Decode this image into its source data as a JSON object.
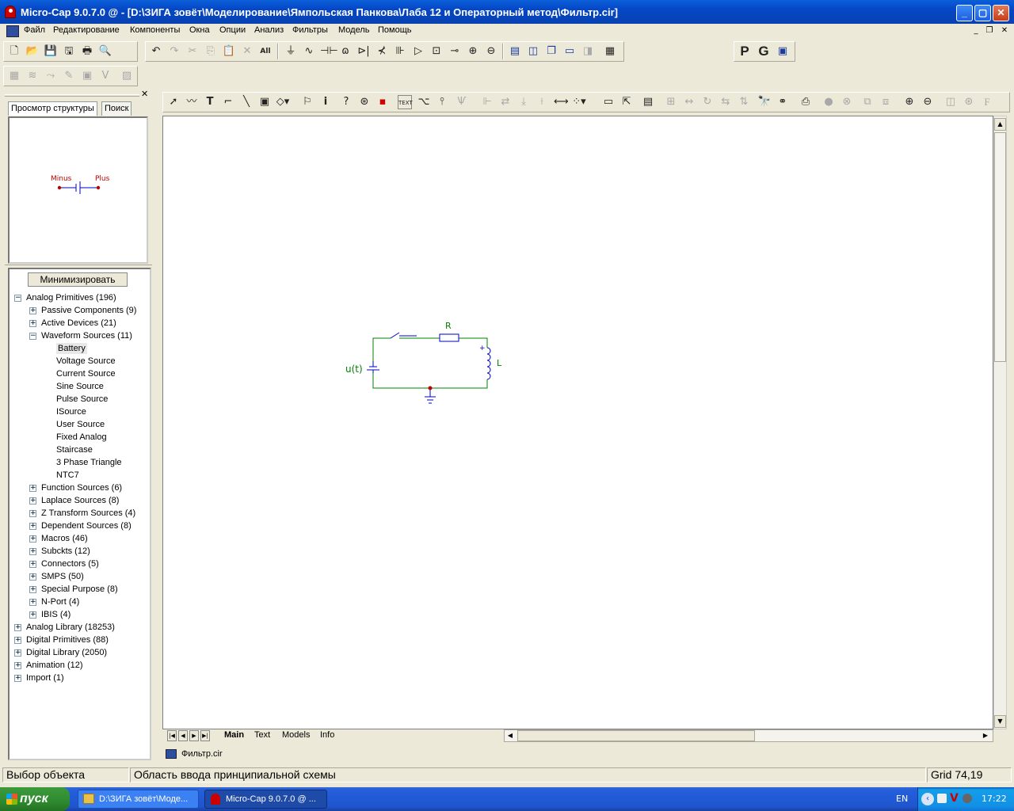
{
  "window": {
    "title": "Micro-Cap 9.0.7.0 @ - [D:\\ЗИГА зовёт\\Моделирование\\Ямпольская Панкова\\Лаба 12 и Операторный метод\\Фильтр.cir]"
  },
  "menu": [
    "Файл",
    "Редактирование",
    "Компоненты",
    "Окна",
    "Опции",
    "Анализ",
    "Фильтры",
    "Модель",
    "Помощь"
  ],
  "toolbar": {
    "p_label": "P",
    "g_label": "G"
  },
  "left_panel": {
    "tabs": [
      "Просмотр структуры",
      "Поиск"
    ],
    "preview": {
      "minus": "Minus",
      "plus": "Plus"
    },
    "minimize_label": "Минимизировать",
    "tree": [
      {
        "label": "Analog Primitives (196)",
        "level": 0,
        "sign": "−"
      },
      {
        "label": "Passive Components (9)",
        "level": 1,
        "sign": "+"
      },
      {
        "label": "Active Devices (21)",
        "level": 1,
        "sign": "+"
      },
      {
        "label": "Waveform Sources (11)",
        "level": 1,
        "sign": "−"
      },
      {
        "label": "Battery",
        "level": 2,
        "selected": true
      },
      {
        "label": "Voltage Source",
        "level": 2
      },
      {
        "label": "Current Source",
        "level": 2
      },
      {
        "label": "Sine Source",
        "level": 2
      },
      {
        "label": "Pulse Source",
        "level": 2
      },
      {
        "label": "ISource",
        "level": 2
      },
      {
        "label": "User Source",
        "level": 2
      },
      {
        "label": "Fixed Analog",
        "level": 2
      },
      {
        "label": "Staircase",
        "level": 2
      },
      {
        "label": "3 Phase Triangle",
        "level": 2
      },
      {
        "label": "NTC7",
        "level": 2
      },
      {
        "label": "Function Sources (6)",
        "level": 1,
        "sign": "+"
      },
      {
        "label": "Laplace Sources (8)",
        "level": 1,
        "sign": "+"
      },
      {
        "label": "Z Transform Sources (4)",
        "level": 1,
        "sign": "+"
      },
      {
        "label": "Dependent Sources (8)",
        "level": 1,
        "sign": "+"
      },
      {
        "label": "Macros (46)",
        "level": 1,
        "sign": "+"
      },
      {
        "label": "Subckts (12)",
        "level": 1,
        "sign": "+"
      },
      {
        "label": "Connectors (5)",
        "level": 1,
        "sign": "+"
      },
      {
        "label": "SMPS (50)",
        "level": 1,
        "sign": "+"
      },
      {
        "label": "Special Purpose (8)",
        "level": 1,
        "sign": "+"
      },
      {
        "label": "N-Port (4)",
        "level": 1,
        "sign": "+"
      },
      {
        "label": "IBIS (4)",
        "level": 1,
        "sign": "+"
      },
      {
        "label": "Analog Library (18253)",
        "level": 0,
        "sign": "+"
      },
      {
        "label": "Digital Primitives (88)",
        "level": 0,
        "sign": "+"
      },
      {
        "label": "Digital Library (2050)",
        "level": 0,
        "sign": "+"
      },
      {
        "label": "Animation (12)",
        "level": 0,
        "sign": "+"
      },
      {
        "label": "Import (1)",
        "level": 0,
        "sign": "+"
      }
    ]
  },
  "schematic": {
    "resistor": "R",
    "inductor": "L",
    "source": "u(t)",
    "plus_mark": "+"
  },
  "page_tabs": [
    "Main",
    "Text",
    "Models",
    "Info"
  ],
  "doc_tab": "Фильтр.cir",
  "status": {
    "left": "Выбор объекта",
    "middle": "Область ввода принципиальной схемы",
    "right": "Grid 74,19"
  },
  "taskbar": {
    "start": "пуск",
    "tasks": [
      "D:\\ЗИГА зовёт\\Моде...",
      "Micro-Cap 9.0.7.0 @ ..."
    ],
    "lang": "EN",
    "time": "17:22"
  },
  "colors": {
    "wire": "#008000",
    "component": "#0000c0",
    "node": "#c00000",
    "label": "#008000"
  }
}
